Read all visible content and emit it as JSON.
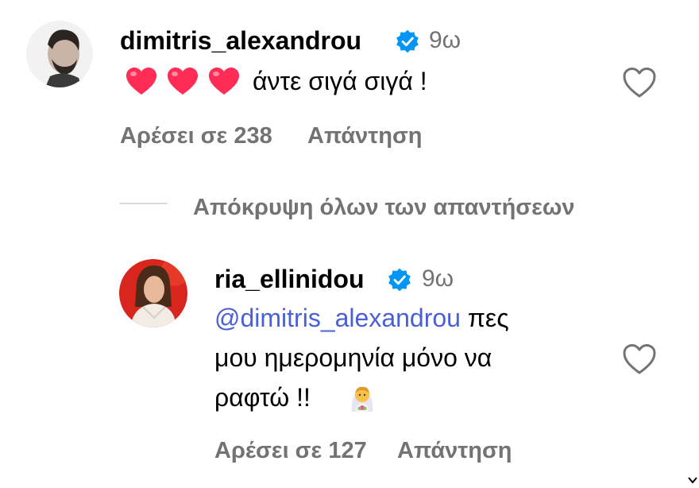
{
  "comments": [
    {
      "username": "dimitris_alexandrou",
      "time": "9ω",
      "emojis": [
        "red-heart",
        "red-heart",
        "red-heart"
      ],
      "text": "άντε σιγά σιγά !",
      "likes_label": "Αρέσει σε 238",
      "reply_label": "Απάντηση"
    }
  ],
  "replies_toggle": "Απόκρυψη όλων των απαντήσεων",
  "reply": {
    "username": "ria_ellinidou",
    "time": "9ω",
    "mention": "@dimitris_alexandrou",
    "text_after_mention": " πες",
    "line2": "μου ημερομηνία μόνο να",
    "line3": "ραφτώ !!",
    "trailing_emoji": "person-with-veil",
    "likes_label": "Αρέσει σε 127",
    "reply_label": "Απάντηση"
  },
  "colors": {
    "verified": "#0095f6",
    "secondary_text": "#737373",
    "mention": "#4b5fd6",
    "heart_emoji": "#ff2d55"
  }
}
